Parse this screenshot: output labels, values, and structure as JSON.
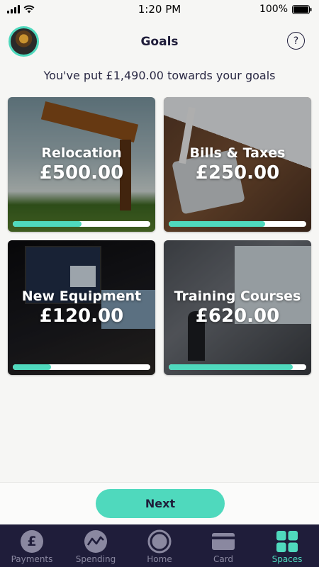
{
  "status_bar": {
    "time": "1:20 PM",
    "battery": "100%"
  },
  "header": {
    "title": "Goals",
    "help_symbol": "?"
  },
  "summary": "You've put £1,490.00 towards your goals",
  "goals": [
    {
      "name": "Relocation",
      "amount": "£500.00",
      "progress": 0.5,
      "image": "angel-sculpture-photo"
    },
    {
      "name": "Bills & Taxes",
      "amount": "£250.00",
      "progress": 0.7,
      "image": "calculator-photo"
    },
    {
      "name": "New Equipment",
      "amount": "£120.00",
      "progress": 0.28,
      "image": "computer-setup-photo"
    },
    {
      "name": "Training Courses",
      "amount": "£620.00",
      "progress": 0.9,
      "image": "presentation-photo"
    }
  ],
  "next_button": {
    "label": "Next"
  },
  "tab_bar": {
    "tabs": [
      {
        "label": "Payments",
        "icon": "pound-coin-icon",
        "active": false
      },
      {
        "label": "Spending",
        "icon": "trend-chart-icon",
        "active": false
      },
      {
        "label": "Home",
        "icon": "home-ring-icon",
        "active": false
      },
      {
        "label": "Card",
        "icon": "card-icon",
        "active": false
      },
      {
        "label": "Spaces",
        "icon": "spaces-grid-icon",
        "active": true
      }
    ],
    "coin_symbol": "£"
  },
  "colors": {
    "accent": "#4fd9bd",
    "navy": "#1f1d3a",
    "inactive": "#8a88a0"
  }
}
